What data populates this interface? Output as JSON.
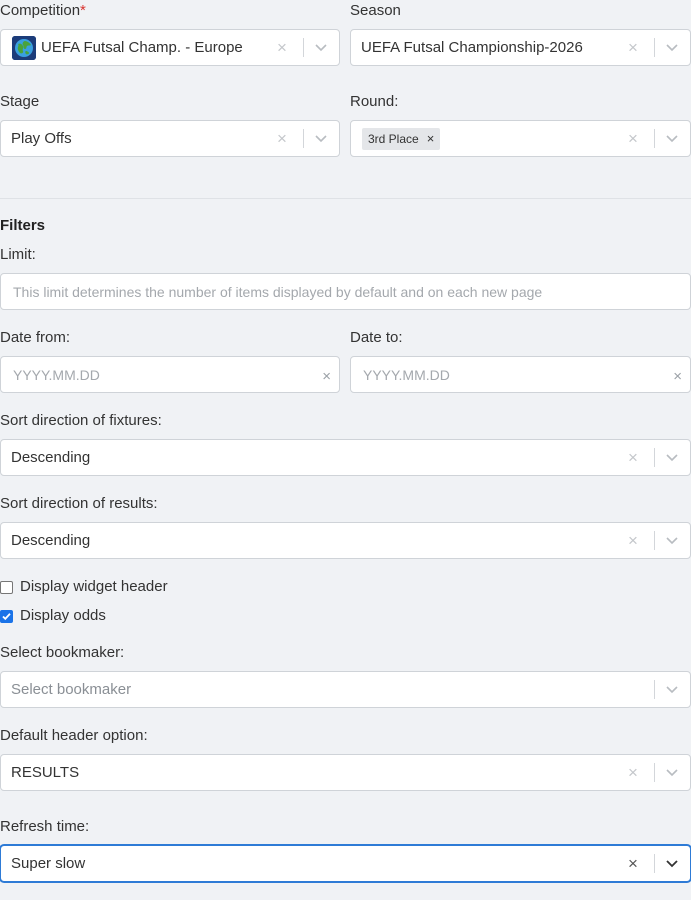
{
  "competition": {
    "label": "Competition",
    "required_mark": "*",
    "value": "UEFA Futsal Champ. - Europe",
    "flag_icon": "globe-icon"
  },
  "season": {
    "label": "Season",
    "value": "UEFA Futsal Championship-2026"
  },
  "stage": {
    "label": "Stage",
    "value": "Play Offs"
  },
  "round": {
    "label": "Round:",
    "chip": "3rd Place",
    "chip_remove": "×"
  },
  "filters": {
    "heading": "Filters",
    "limit": {
      "label": "Limit:",
      "placeholder": "This limit determines the number of items displayed by default and on each new page"
    },
    "date_from": {
      "label": "Date from:",
      "placeholder": "YYYY.MM.DD"
    },
    "date_to": {
      "label": "Date to:",
      "placeholder": "YYYY.MM.DD"
    },
    "sort_fixtures": {
      "label": "Sort direction of fixtures:",
      "value": "Descending"
    },
    "sort_results": {
      "label": "Sort direction of results:",
      "value": "Descending"
    },
    "display_widget_header": {
      "label": "Display widget header",
      "checked": false
    },
    "display_odds": {
      "label": "Display odds",
      "checked": true
    },
    "bookmaker": {
      "label": "Select bookmaker:",
      "placeholder": "Select bookmaker"
    },
    "default_header": {
      "label": "Default header option:",
      "value": "RESULTS"
    },
    "refresh_time": {
      "label": "Refresh time:",
      "value": "Super slow"
    }
  },
  "icons": {
    "clear": "×",
    "chevron": "chevron-down-icon"
  },
  "colors": {
    "accent": "#2e7bd6",
    "checkbox": "#1a73e8",
    "required": "#d9332f"
  }
}
